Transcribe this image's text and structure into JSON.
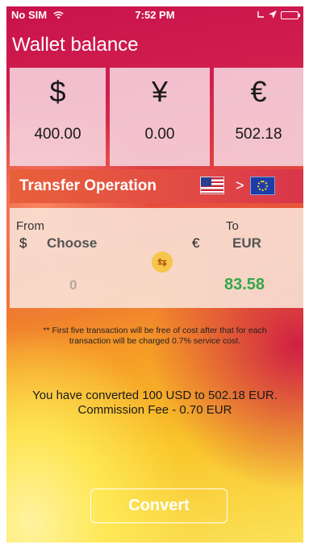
{
  "status_bar": {
    "carrier": "No SIM",
    "wifi_icon": "wifi-icon",
    "time": "7:52 PM",
    "location_icon": "location-arrow-icon",
    "battery_icon": "battery-icon",
    "battery_level": 1.0
  },
  "header": {
    "title": "Wallet balance"
  },
  "balances": [
    {
      "symbol": "$",
      "amount": "400.00"
    },
    {
      "symbol": "¥",
      "amount": "0.00"
    },
    {
      "symbol": "€",
      "amount": "502.18"
    }
  ],
  "transfer": {
    "label": "Transfer Operation",
    "from_flag_icon": "us-flag-icon",
    "separator": ">",
    "to_flag_icon": "eu-flag-icon"
  },
  "conversion": {
    "from_label": "From",
    "to_label": "To",
    "from_symbol": "$",
    "from_currency": "Choose",
    "to_symbol": "€",
    "to_currency": "EUR",
    "swap_icon": "swap-arrows-icon",
    "swap_glyph": "⇆",
    "from_amount": "0",
    "to_amount": "83.58"
  },
  "note": "** First five transaction will be free of cost after that for each transaction will be charged 0.7% service cost.",
  "result": {
    "line1": "You have converted 100 USD to 502.18 EUR.",
    "line2": "Commission Fee - 0.70 EUR"
  },
  "convert_button": {
    "label": "Convert"
  },
  "colors": {
    "background_top": "#c8134b",
    "background_bottom": "#fbe158",
    "positive_amount": "#34a84a",
    "swap_button": "#f6c64a"
  }
}
